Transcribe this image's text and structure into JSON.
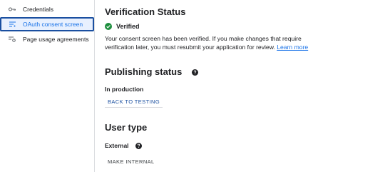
{
  "sidebar": {
    "items": [
      {
        "label": "Credentials",
        "icon": "key-icon"
      },
      {
        "label": "OAuth consent screen",
        "icon": "list-icon",
        "active": true
      },
      {
        "label": "Page usage agreements",
        "icon": "settings-list-icon"
      }
    ]
  },
  "verification": {
    "title": "Verification Status",
    "status": "Verified",
    "message": "Your consent screen has been verified. If you make changes that require verification later, you must resubmit your application for review.",
    "link": "Learn more"
  },
  "publishing": {
    "title": "Publishing status",
    "state": "In production",
    "button": "BACK TO TESTING"
  },
  "user_type": {
    "title": "User type",
    "value": "External",
    "button": "MAKE INTERNAL"
  },
  "colors": {
    "accent": "#1a73e8",
    "success": "#1e8e3e",
    "active_bg": "#e8f0fe"
  }
}
